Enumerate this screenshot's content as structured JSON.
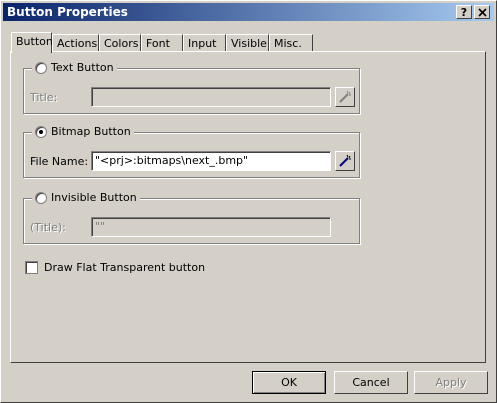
{
  "window": {
    "title": "Button Properties",
    "help_label": "?",
    "close_label": "✕"
  },
  "tabs": [
    {
      "label": "Button"
    },
    {
      "label": "Actions"
    },
    {
      "label": "Colors"
    },
    {
      "label": "Font"
    },
    {
      "label": "Input"
    },
    {
      "label": "Visible"
    },
    {
      "label": "Misc."
    }
  ],
  "text_button": {
    "label": "Text Button",
    "field_label": "Title:",
    "field_value": "",
    "checked": false
  },
  "bitmap_button": {
    "label": "Bitmap Button",
    "field_label": "File Name:",
    "field_value": "\"<prj>:bitmaps\\next_.bmp\"",
    "checked": true
  },
  "invisible_button": {
    "label": "Invisible Button",
    "field_label": "(Title):",
    "field_value": "\"\"",
    "checked": false
  },
  "flat_transparent": {
    "label": "Draw Flat Transparent button",
    "checked": false
  },
  "buttons": {
    "ok": "OK",
    "cancel": "Cancel",
    "apply": "Apply"
  },
  "icons": {
    "browse": "wand-browse-icon"
  }
}
